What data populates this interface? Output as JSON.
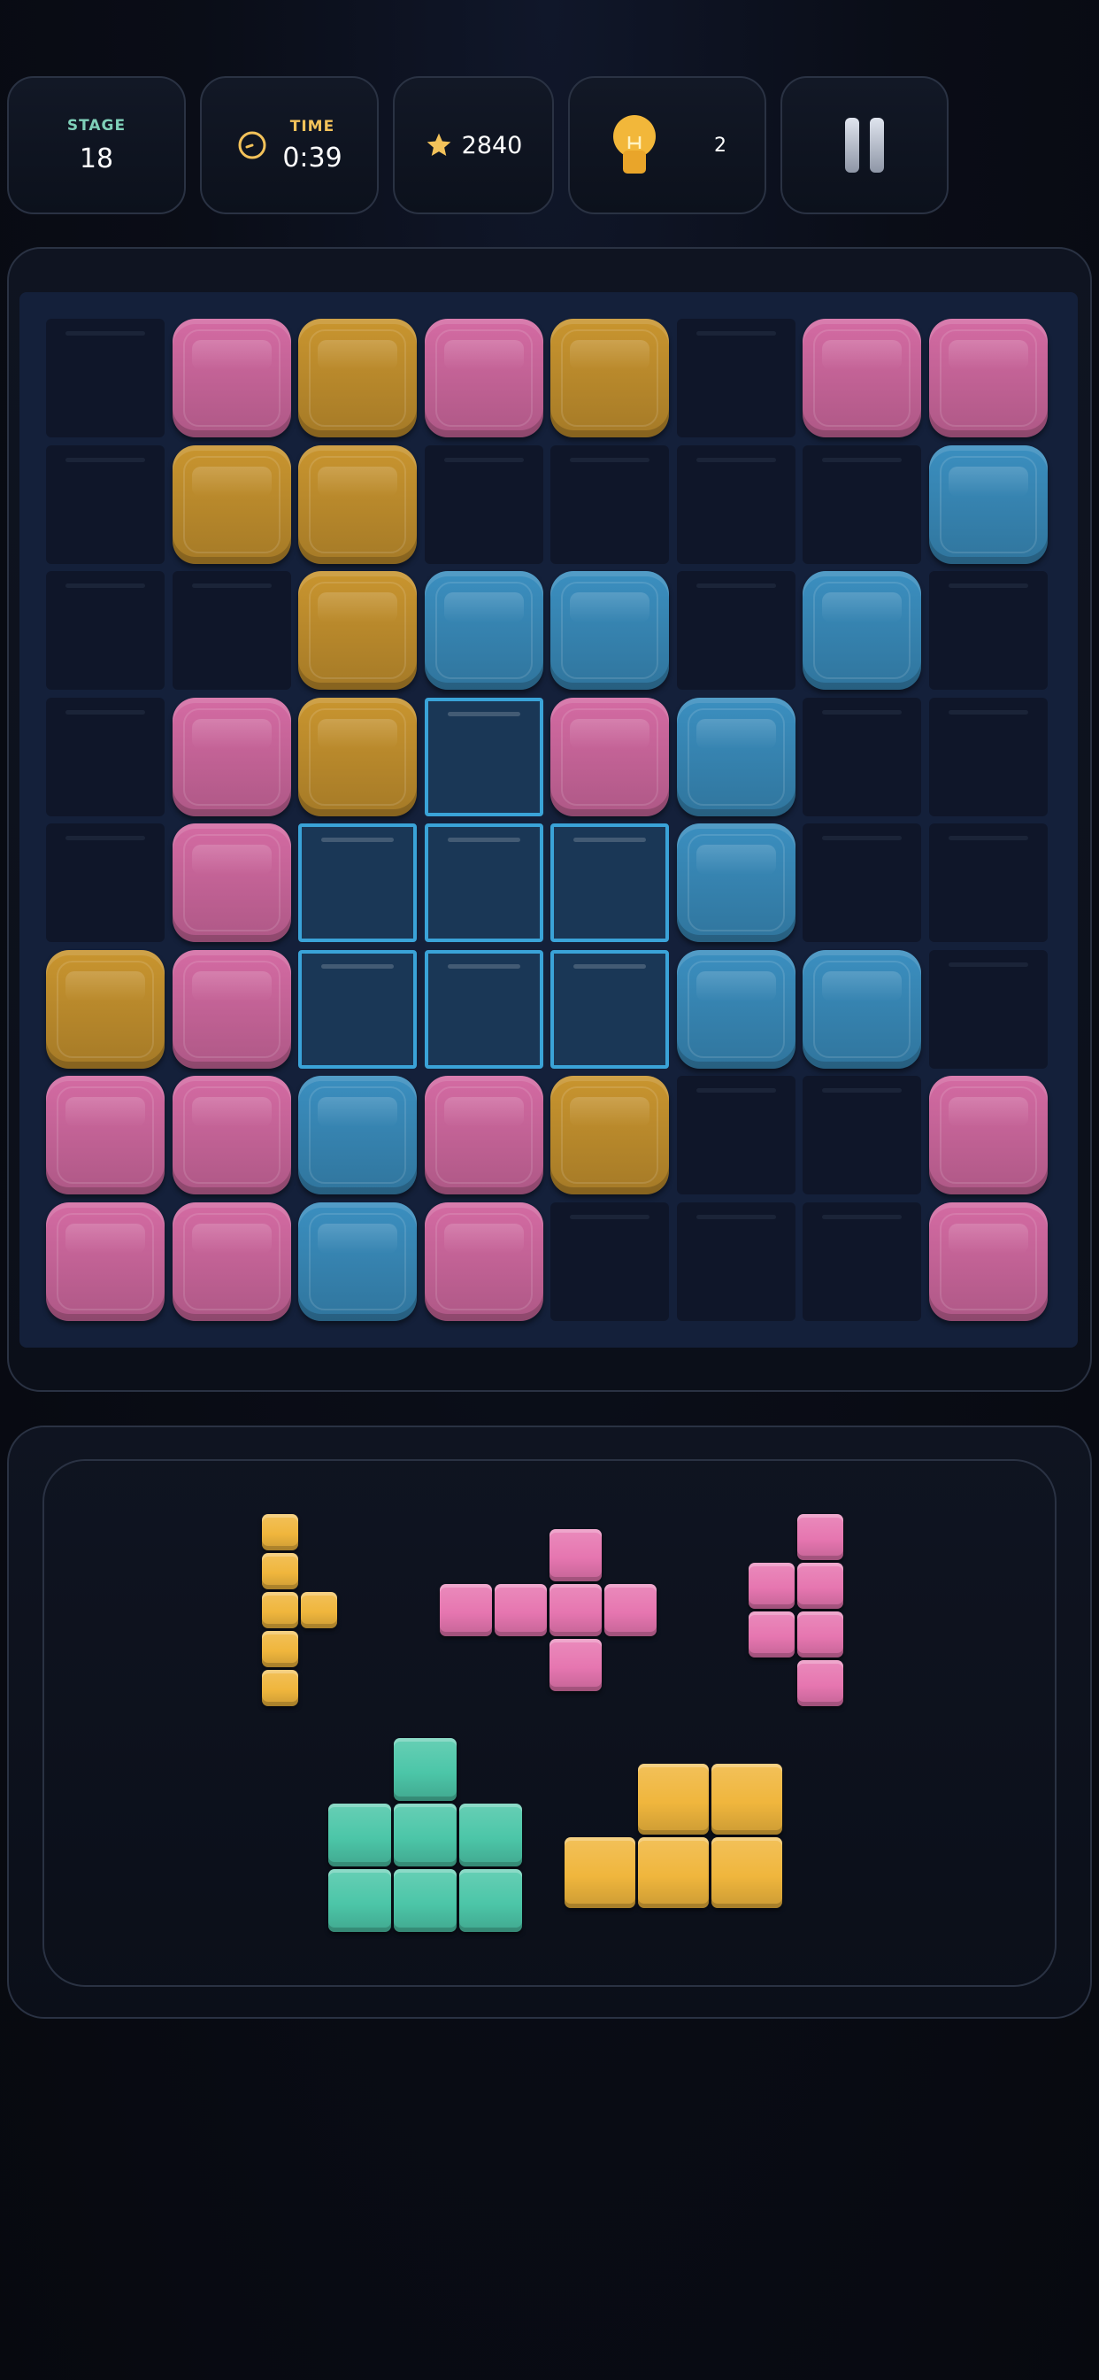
{
  "hud": {
    "stage_label": "STAGE",
    "stage_value": "18",
    "time_label": "TIME",
    "time_value": "0:39",
    "score_value": "2840",
    "hint_count": "2",
    "icons": {
      "clock": "clock-icon",
      "star": "star-icon",
      "hint": "lightbulb-icon",
      "pause": "pause-icon"
    }
  },
  "colors": {
    "pink": "#d46ba3",
    "gold": "#c9952f",
    "blue": "#3b8fc0",
    "ghost": "#3aa3d8",
    "teal": "#4cc6a8",
    "tray_gold": "#f0b63d",
    "tray_pink": "#e676b0"
  },
  "board": {
    "rows": 8,
    "cols": 8,
    "cells": [
      [
        ".",
        "P",
        "G",
        "P",
        "G",
        ".",
        "P",
        "P"
      ],
      [
        ".",
        "G",
        "G",
        ".",
        ".",
        ".",
        ".",
        "B"
      ],
      [
        ".",
        ".",
        "G",
        "B",
        "B",
        ".",
        "B",
        "."
      ],
      [
        ".",
        "P",
        "G",
        "X",
        "P",
        "B",
        ".",
        "."
      ],
      [
        ".",
        "P",
        "X",
        "X",
        "X",
        "B",
        ".",
        "."
      ],
      [
        "G",
        "P",
        "X",
        "X",
        "X",
        "B",
        "B",
        "."
      ],
      [
        "P",
        "P",
        "B",
        "P",
        "G",
        ".",
        ".",
        "P"
      ],
      [
        "P",
        "P",
        "B",
        "P",
        ".",
        ".",
        ".",
        "P"
      ]
    ],
    "legend": {
      ".": "empty",
      "P": "pink",
      "G": "gold",
      "B": "blue",
      "X": "ghost-preview"
    }
  },
  "tray": {
    "pieces": [
      {
        "name": "tray-piece-gold-t",
        "color": "tray_gold",
        "cells": [
          [
            0,
            0
          ],
          [
            0,
            1
          ],
          [
            0,
            2
          ],
          [
            1,
            2
          ],
          [
            0,
            3
          ],
          [
            0,
            4
          ]
        ]
      },
      {
        "name": "tray-piece-pink-plus",
        "color": "tray_pink",
        "cells": [
          [
            2,
            0
          ],
          [
            0,
            1
          ],
          [
            1,
            1
          ],
          [
            2,
            1
          ],
          [
            3,
            1
          ],
          [
            2,
            2
          ]
        ]
      },
      {
        "name": "tray-piece-pink-s",
        "color": "tray_pink",
        "cells": [
          [
            1,
            0
          ],
          [
            0,
            1
          ],
          [
            1,
            1
          ],
          [
            0,
            2
          ],
          [
            1,
            2
          ],
          [
            1,
            3
          ]
        ]
      },
      {
        "name": "tray-piece-teal-t",
        "color": "teal",
        "cells": [
          [
            1,
            0
          ],
          [
            0,
            1
          ],
          [
            1,
            1
          ],
          [
            2,
            1
          ],
          [
            0,
            2
          ],
          [
            1,
            2
          ],
          [
            2,
            2
          ]
        ]
      },
      {
        "name": "tray-piece-gold-l",
        "color": "tray_gold",
        "cells": [
          [
            1,
            0
          ],
          [
            2,
            0
          ],
          [
            0,
            1
          ],
          [
            1,
            1
          ],
          [
            2,
            1
          ]
        ]
      }
    ]
  }
}
